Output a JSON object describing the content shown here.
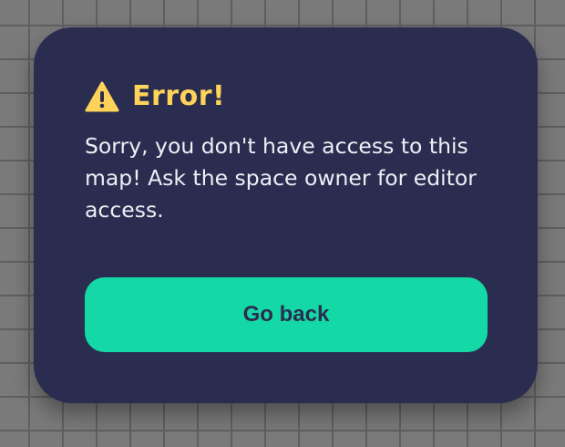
{
  "dialog": {
    "title": "Error!",
    "icon": "warning-triangle-icon",
    "accent_color": "#ffd35a",
    "message": "Sorry, you don't have access to this map! Ask the space owner for editor access.",
    "primary_button": {
      "label": "Go back",
      "color": "#14d9a6"
    }
  }
}
